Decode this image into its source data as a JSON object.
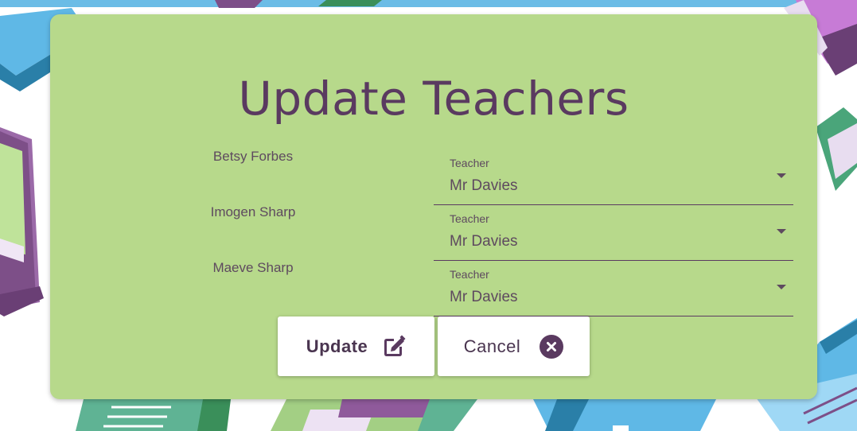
{
  "page": {
    "title": "Update Teachers"
  },
  "students": [
    {
      "name": "Betsy Forbes",
      "field_label": "Teacher",
      "teacher": "Mr Davies"
    },
    {
      "name": "Imogen Sharp",
      "field_label": "Teacher",
      "teacher": "Mr Davies"
    },
    {
      "name": "Maeve Sharp",
      "field_label": "Teacher",
      "teacher": "Mr Davies"
    }
  ],
  "actions": {
    "update_label": "Update",
    "update_icon": "edit-icon",
    "cancel_label": "Cancel",
    "cancel_icon": "close-circle-icon"
  },
  "colors": {
    "card_background": "#b7d98b",
    "text": "#5a3a60",
    "top_bar": "#6bbce6"
  }
}
